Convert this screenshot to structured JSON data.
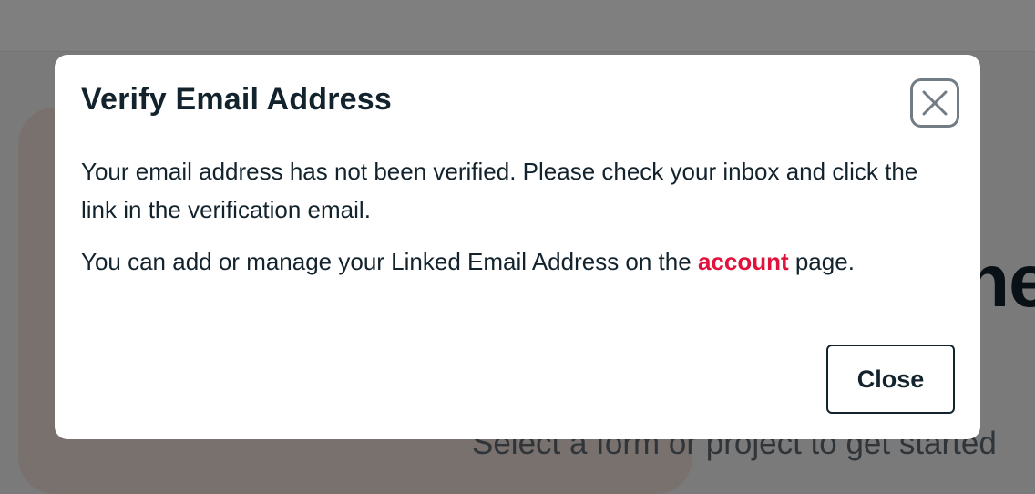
{
  "background": {
    "heading_fragment": "ne",
    "subtitle": "Select a form or project to get started"
  },
  "modal": {
    "title": "Verify Email Address",
    "close_icon": "close-x-icon",
    "paragraph1": "Your email address has not been verified. Please check your inbox and click the link in the verification email.",
    "paragraph2_before": "You can add or manage your Linked Email Address on the ",
    "paragraph2_link": "account",
    "paragraph2_after": " page.",
    "close_button_label": "Close"
  },
  "colors": {
    "link": "#e0113a",
    "text": "#13232d",
    "overlay": "rgba(0,0,0,0.5)"
  }
}
